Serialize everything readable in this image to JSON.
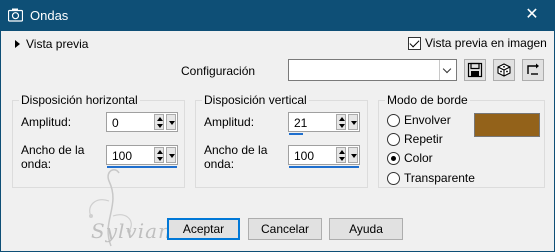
{
  "window": {
    "title": "Ondas",
    "close_glyph": "✕"
  },
  "preview": {
    "label": "Vista previa"
  },
  "preview_in_image": {
    "label": "Vista previa en imagen",
    "checked": true
  },
  "config": {
    "label": "Configuración",
    "value": ""
  },
  "toolbar_icons": [
    "save-icon",
    "dice-icon",
    "reset-icon"
  ],
  "horizontal": {
    "title": "Disposición horizontal",
    "amplitude_label": "Amplitud:",
    "amplitude_value": "0",
    "wavelength_label_1": "Ancho de la",
    "wavelength_label_2": "onda:",
    "wavelength_value": "100"
  },
  "vertical": {
    "title": "Disposición vertical",
    "amplitude_label": "Amplitud:",
    "amplitude_value": "21",
    "wavelength_label_1": "Ancho de la",
    "wavelength_label_2": "onda:",
    "wavelength_value": "100"
  },
  "edge_mode": {
    "title": "Modo de borde",
    "options": [
      "Envolver",
      "Repetir",
      "Color",
      "Transparente"
    ],
    "selected": "Color",
    "color": "#93621a"
  },
  "buttons": {
    "ok": "Aceptar",
    "cancel": "Cancelar",
    "help": "Ayuda"
  },
  "watermark": {
    "text": "Sylviane"
  }
}
